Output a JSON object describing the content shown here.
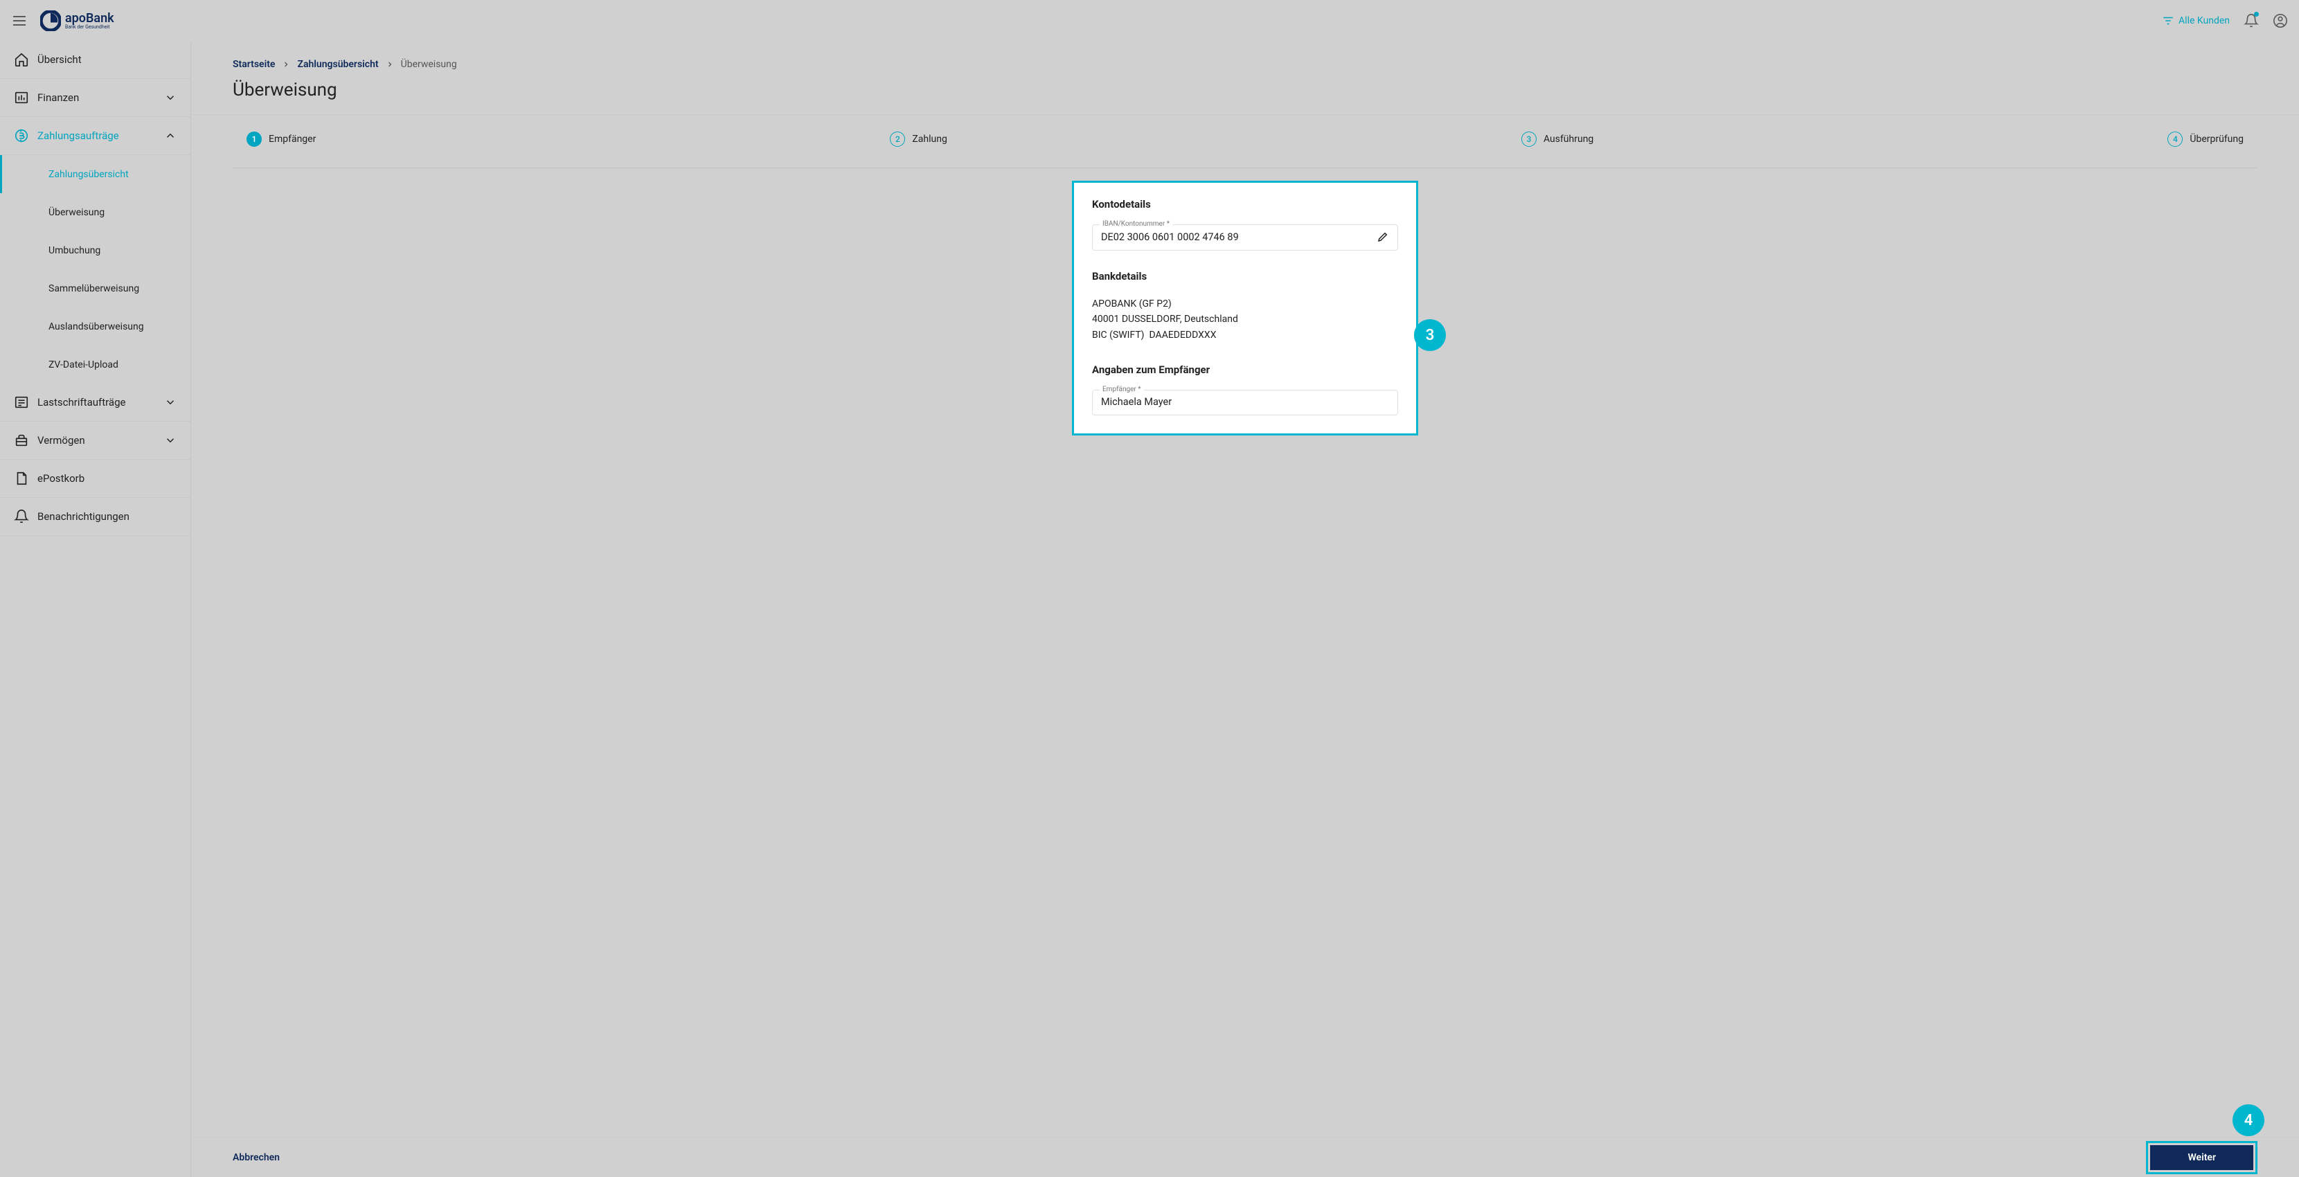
{
  "header": {
    "brand": "apoBank",
    "tagline": "Bank der Gesundheit",
    "filter_label": "Alle Kunden"
  },
  "sidebar": {
    "items": [
      {
        "label": "Übersicht"
      },
      {
        "label": "Finanzen"
      },
      {
        "label": "Zahlungsaufträge"
      },
      {
        "label": "Lastschriftaufträge"
      },
      {
        "label": "Vermögen"
      },
      {
        "label": "ePostkorb"
      },
      {
        "label": "Benachrichtigungen"
      }
    ],
    "sub_items": [
      {
        "label": "Zahlungsübersicht"
      },
      {
        "label": "Überweisung"
      },
      {
        "label": "Umbuchung"
      },
      {
        "label": "Sammelüberweisung"
      },
      {
        "label": "Auslandsüberweisung"
      },
      {
        "label": "ZV-Datei-Upload"
      }
    ]
  },
  "breadcrumb": {
    "items": [
      "Startseite",
      "Zahlungsübersicht"
    ],
    "current": "Überweisung"
  },
  "page_title": "Überweisung",
  "stepper": [
    {
      "num": "1",
      "label": "Empfänger"
    },
    {
      "num": "2",
      "label": "Zahlung"
    },
    {
      "num": "3",
      "label": "Ausführung"
    },
    {
      "num": "4",
      "label": "Überprüfung"
    }
  ],
  "card": {
    "section1_title": "Kontodetails",
    "iban_label": "IBAN/Kontonummer *",
    "iban_value": "DE02 3006 0601 0002 4746 89",
    "section2_title": "Bankdetails",
    "bank_name": "APOBANK (GF P2)",
    "bank_city": "40001 DUSSELDORF, Deutschland",
    "bic_label": "BIC (SWIFT)",
    "bic_value": "DAAEDEDDXXX",
    "section3_title": "Angaben zum Empfänger",
    "recipient_label": "Empfänger *",
    "recipient_value": "Michaela Mayer"
  },
  "annotations": {
    "card_bubble": "3",
    "button_bubble": "4"
  },
  "footer": {
    "cancel": "Abbrechen",
    "next": "Weiter"
  }
}
